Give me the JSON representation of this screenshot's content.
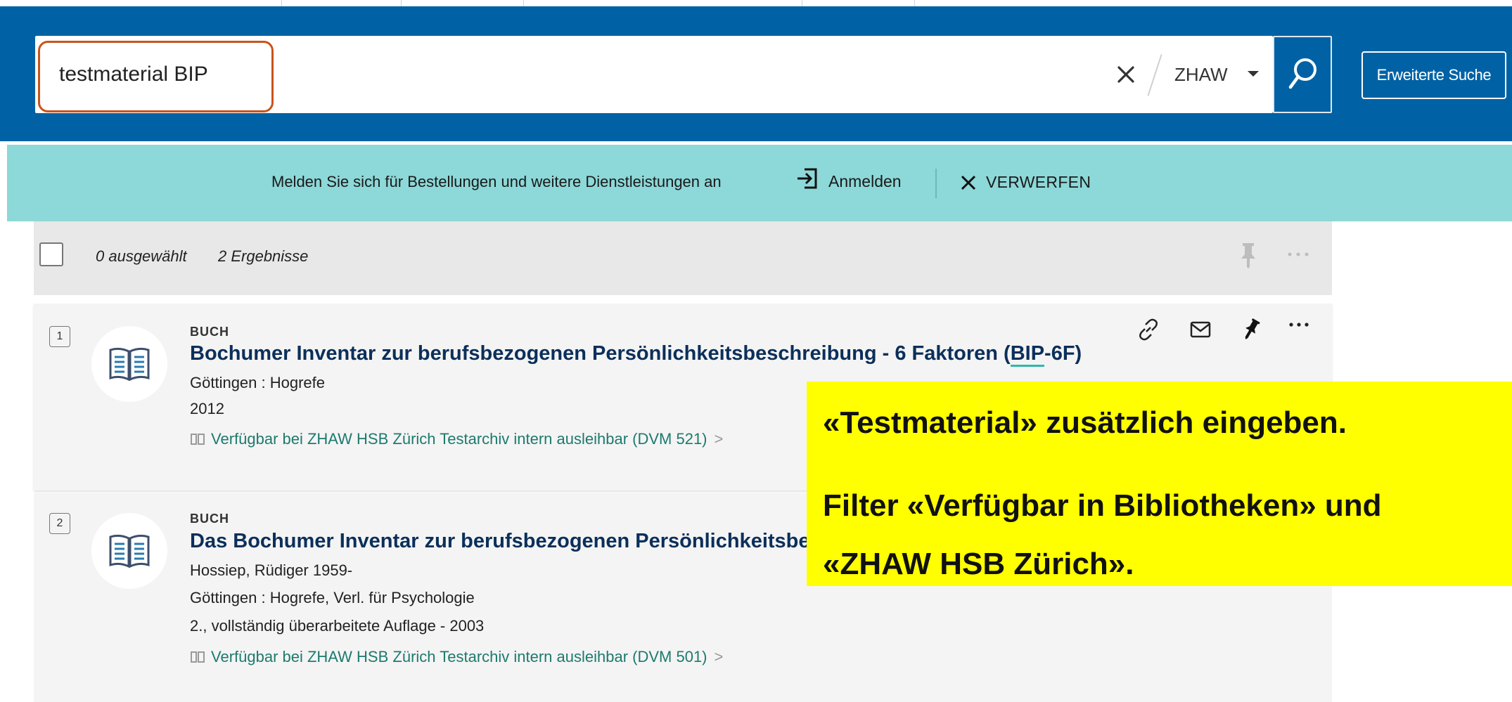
{
  "search": {
    "query": "testmaterial BIP",
    "scope": "ZHAW",
    "advanced_label": "Erweiterte Suche"
  },
  "login_banner": {
    "message": "Melden Sie sich für Bestellungen und weitere Dienstleistungen an",
    "login_label": "Anmelden",
    "dismiss_label": "VERWERFEN"
  },
  "results_toolbar": {
    "selected": "0 ausgewählt",
    "count": "2 Ergebnisse"
  },
  "results": [
    {
      "index": "1",
      "type": "BUCH",
      "title_pre": "Bochumer Inventar zur berufsbezogenen Persönlichkeitsbeschreibung - 6 Faktoren (",
      "title_match": "BIP",
      "title_post": "-6F)",
      "meta": [
        "Göttingen : Hogrefe",
        "2012"
      ],
      "availability": "Verfügbar bei ZHAW HSB Zürich  Testarchiv intern ausleihbar (DVM 521)",
      "chevron": ">"
    },
    {
      "index": "2",
      "type": "BUCH",
      "title": "Das Bochumer Inventar zur berufsbezogenen Persönlichkeitsbesc",
      "meta": [
        "Hossiep, Rüdiger 1959-",
        "Göttingen : Hogrefe, Verl. für Psychologie",
        "2., vollständig überarbeitete Auflage - 2003"
      ],
      "availability": "Verfügbar bei ZHAW HSB Zürich  Testarchiv intern ausleihbar (DVM 501)",
      "chevron": ">"
    }
  ],
  "callout": {
    "line_1": "«Testmaterial» zusätzlich eingeben.",
    "line_2": "Filter «Verfügbar in Bibliotheken» und",
    "line_3": "«ZHAW HSB Zürich»."
  },
  "colors": {
    "header": "#0062a5",
    "banner": "#8dd8d8",
    "highlight_border": "#c9531c",
    "callout": "#ffff00",
    "availability": "#1d7a6e"
  },
  "icons": [
    "clear-icon",
    "caret-down-icon",
    "search-icon",
    "login-icon",
    "close-icon",
    "pin-icon",
    "more-icon",
    "book-icon",
    "link-icon",
    "mail-icon"
  ]
}
